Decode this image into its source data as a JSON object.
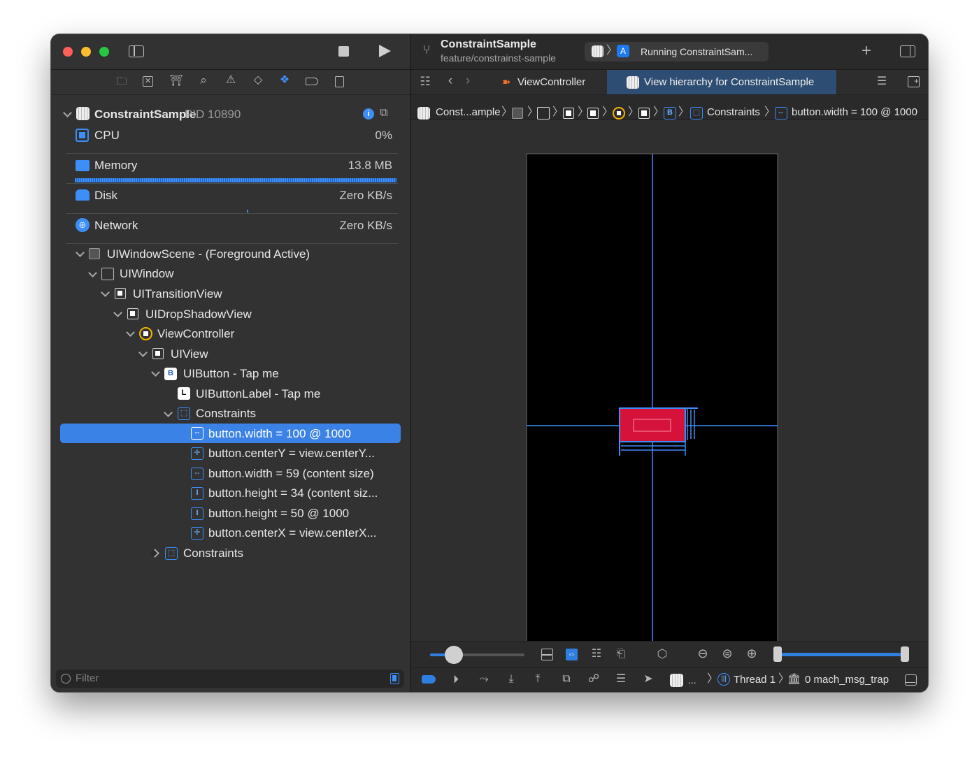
{
  "project": {
    "name": "ConstraintSample",
    "pid": "PID 10890",
    "branch": "feature/constrainst-sample"
  },
  "status": {
    "running": "Running ConstraintSam..."
  },
  "tabs": [
    {
      "label": "ViewController",
      "active": false
    },
    {
      "label": "View hierarchy for ConstraintSample",
      "active": true
    }
  ],
  "breadcrumb": {
    "first": "Const...ample",
    "constraints": "Constraints",
    "last": "button.width = 100 @ 1000"
  },
  "gauges": [
    {
      "label": "CPU",
      "value": "0%",
      "icon": "cpu-icon"
    },
    {
      "label": "Memory",
      "value": "13.8 MB",
      "icon": "memory-icon"
    },
    {
      "label": "Disk",
      "value": "Zero KB/s",
      "icon": "disk-icon"
    },
    {
      "label": "Network",
      "value": "Zero KB/s",
      "icon": "network-icon"
    }
  ],
  "tree": [
    {
      "label": "UIWindowScene - (Foreground Active)",
      "depth": 0,
      "expanded": true,
      "kind": "scene"
    },
    {
      "label": "UIWindow",
      "depth": 1,
      "expanded": true,
      "kind": "view-empty"
    },
    {
      "label": "UITransitionView",
      "depth": 2,
      "expanded": true,
      "kind": "view"
    },
    {
      "label": "UIDropShadowView",
      "depth": 3,
      "expanded": true,
      "kind": "view"
    },
    {
      "label": "ViewController",
      "depth": 4,
      "expanded": true,
      "kind": "controller"
    },
    {
      "label": "UIView",
      "depth": 5,
      "expanded": true,
      "kind": "view"
    },
    {
      "label": "UIButton - Tap me",
      "depth": 6,
      "expanded": true,
      "kind": "button"
    },
    {
      "label": "UIButtonLabel - Tap me",
      "depth": 7,
      "expanded": null,
      "kind": "label"
    },
    {
      "label": "Constraints",
      "depth": 7,
      "expanded": true,
      "kind": "constraints"
    },
    {
      "label": "button.width = 100 @ 1000",
      "depth": 8,
      "expanded": null,
      "kind": "h-constraint",
      "selected": true
    },
    {
      "label": "button.centerY = view.centerY...",
      "depth": 8,
      "expanded": null,
      "kind": "center-constraint"
    },
    {
      "label": "button.width = 59 (content size)",
      "depth": 8,
      "expanded": null,
      "kind": "h-constraint"
    },
    {
      "label": "button.height = 34 (content siz...",
      "depth": 8,
      "expanded": null,
      "kind": "v-constraint"
    },
    {
      "label": "button.height = 50 @ 1000",
      "depth": 8,
      "expanded": null,
      "kind": "v-constraint"
    },
    {
      "label": "button.centerX = view.centerX...",
      "depth": 8,
      "expanded": null,
      "kind": "center-constraint"
    },
    {
      "label": "Constraints",
      "depth": 6,
      "expanded": false,
      "kind": "constraints"
    }
  ],
  "filter": {
    "placeholder": "Filter"
  },
  "debugbar": {
    "thread": "Thread 1",
    "frame": "0 mach_msg_trap",
    "ellipsis": "..."
  },
  "colors": {
    "accent": "#2f7fe0",
    "selection": "#3a82e6",
    "button_fill": "#d4123a",
    "constraint_line": "#3d8ef7"
  }
}
